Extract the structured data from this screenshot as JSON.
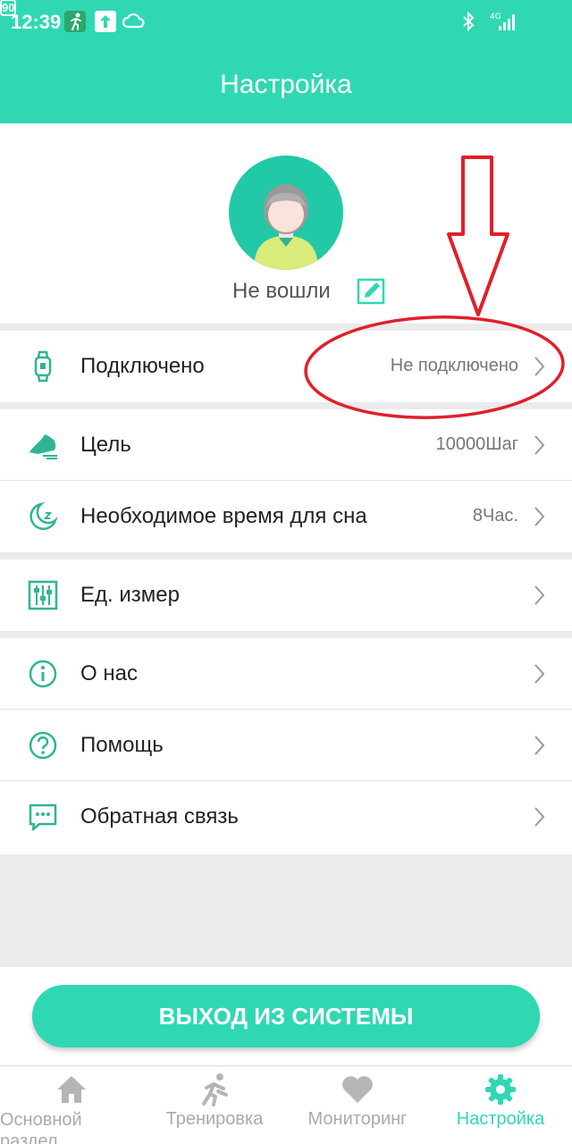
{
  "status_bar": {
    "time": "12:39",
    "battery": "90",
    "icons": [
      "fitness-app-icon",
      "upload-icon",
      "cloud-icon",
      "bluetooth-icon",
      "signal-4g-icon",
      "battery-icon"
    ]
  },
  "header": {
    "title": "Настройка"
  },
  "profile": {
    "login_status": "Не вошли"
  },
  "settings": {
    "connected": {
      "label": "Подключено",
      "value": "Не подключено",
      "icon": "watch-icon"
    },
    "goal": {
      "label": "Цель",
      "value": "10000Шаг",
      "icon": "shoe-icon"
    },
    "sleep": {
      "label": "Необходимое время для сна",
      "value": "8Час.",
      "icon": "moon-icon"
    },
    "units": {
      "label": "Ед. измер",
      "icon": "sliders-icon"
    },
    "about": {
      "label": "О нас",
      "icon": "info-icon"
    },
    "help": {
      "label": "Помощь",
      "icon": "help-icon"
    },
    "feedback": {
      "label": "Обратная связь",
      "icon": "chat-icon"
    }
  },
  "logout": {
    "label": "ВЫХОД ИЗ СИСТЕМЫ"
  },
  "tabs": [
    {
      "label": "Основной раздел",
      "icon": "home-icon",
      "active": false
    },
    {
      "label": "Тренировка",
      "icon": "run-icon",
      "active": false
    },
    {
      "label": "Мониторинг",
      "icon": "heart-icon",
      "active": false
    },
    {
      "label": "Настройка",
      "icon": "gear-icon",
      "active": true
    }
  ],
  "colors": {
    "accent": "#2fd8b3",
    "annotation": "#e0202a",
    "inactive": "#aaaaaa"
  }
}
